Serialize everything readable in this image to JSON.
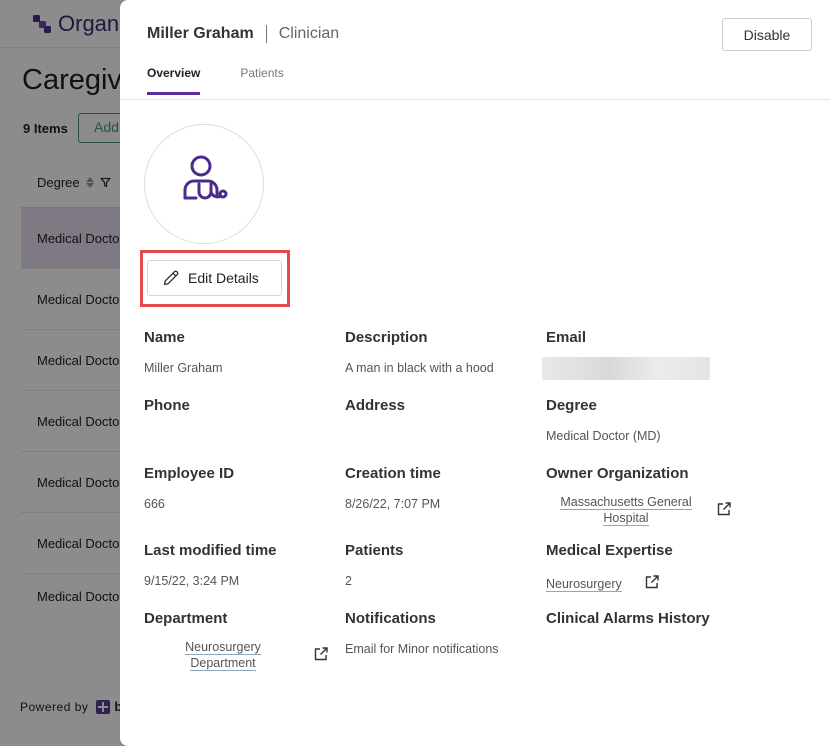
{
  "background": {
    "logo_text": "Organ",
    "page_title": "Caregivers",
    "items_count": "9 Items",
    "add_button": "Add",
    "column_header": "Degree",
    "rows": [
      "Medical Doctor (MD)",
      "Medical Doctor (MD)",
      "Medical Doctor (MD)",
      "Medical Doctor (MD)",
      "Medical Doctor (MD)",
      "Medical Doctor (MD)",
      "Medical Doctor (MD)"
    ],
    "powered_by": "Powered by",
    "powered_brand": "b"
  },
  "drawer": {
    "name": "Miller Graham",
    "role": "Clinician",
    "disable_button": "Disable",
    "tabs": [
      {
        "label": "Overview",
        "active": true
      },
      {
        "label": "Patients",
        "active": false
      }
    ],
    "avatar_icon": "doctor-stethoscope-icon",
    "edit_button": "Edit Details",
    "fields": {
      "name": {
        "label": "Name",
        "value": "Miller Graham"
      },
      "description": {
        "label": "Description",
        "value": "A man in black with a hood"
      },
      "email": {
        "label": "Email",
        "value": ""
      },
      "phone": {
        "label": "Phone",
        "value": ""
      },
      "address": {
        "label": "Address",
        "value": ""
      },
      "degree": {
        "label": "Degree",
        "value": "Medical Doctor (MD)"
      },
      "employee_id": {
        "label": "Employee ID",
        "value": "666"
      },
      "creation_time": {
        "label": "Creation time",
        "value": "8/26/22, 7:07 PM"
      },
      "owner_org": {
        "label": "Owner Organization",
        "value_line1": "Massachusetts General",
        "value_line2": "Hospital"
      },
      "last_modified": {
        "label": "Last modified time",
        "value": "9/15/22, 3:24 PM"
      },
      "patients": {
        "label": "Patients",
        "value": "2"
      },
      "medical_expertise": {
        "label": "Medical Expertise",
        "value": "Neurosurgery"
      },
      "department": {
        "label": "Department",
        "value_line1": "Neurosurgery",
        "value_line2": "Department"
      },
      "notifications": {
        "label": "Notifications",
        "value": "Email for Minor notifications"
      },
      "clinical_alarms": {
        "label": "Clinical Alarms History",
        "value": ""
      }
    }
  },
  "colors": {
    "accent": "#5b2e9e",
    "highlight_border": "#e5484d",
    "overlay": "rgba(0,0,0,0.45)"
  }
}
